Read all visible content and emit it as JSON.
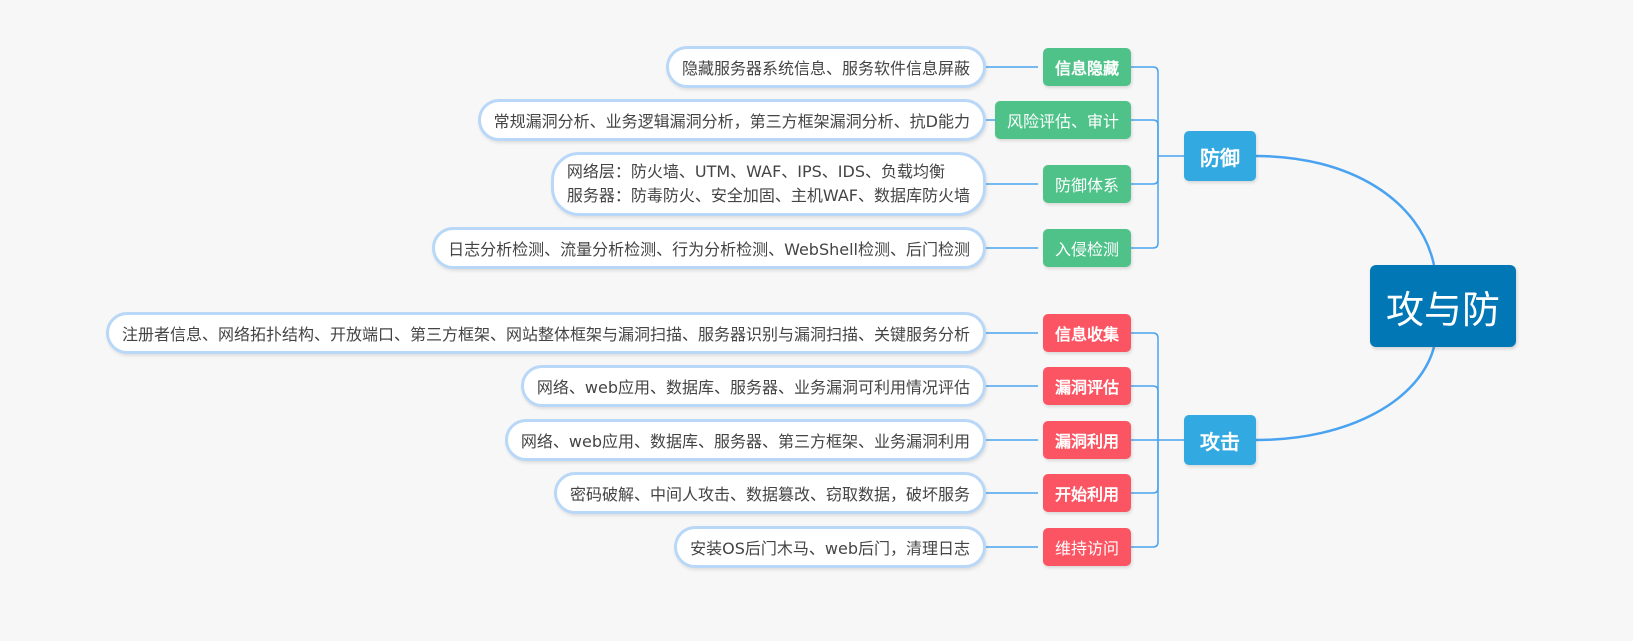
{
  "root": {
    "label": "攻与防"
  },
  "colors": {
    "root": "#0277b5",
    "main": "#32a9e0",
    "defense_sub": "#4fc28a",
    "attack_sub": "#fb5462",
    "connector": "#4aa3f0",
    "leaf_border": "#b9d8f8",
    "background": "#f7f7f7"
  },
  "branches": [
    {
      "label": "防御",
      "children": [
        {
          "label": "信息隐藏",
          "bold": true,
          "detail": [
            "隐藏服务器系统信息、服务软件信息屏蔽"
          ]
        },
        {
          "label": "风险评估、审计",
          "bold": false,
          "detail": [
            "常规漏洞分析、业务逻辑漏洞分析，第三方框架漏洞分析、抗D能力"
          ]
        },
        {
          "label": "防御体系",
          "bold": false,
          "detail": [
            "网络层：防火墙、UTM、WAF、IPS、IDS、负载均衡",
            "服务器：防毒防火、安全加固、主机WAF、数据库防火墙"
          ]
        },
        {
          "label": "入侵检测",
          "bold": false,
          "detail": [
            "日志分析检测、流量分析检测、行为分析检测、WebShell检测、后门检测"
          ]
        }
      ]
    },
    {
      "label": "攻击",
      "children": [
        {
          "label": "信息收集",
          "bold": true,
          "detail": [
            "注册者信息、网络拓扑结构、开放端口、第三方框架、网站整体框架与漏洞扫描、服务器识别与漏洞扫描、关键服务分析"
          ]
        },
        {
          "label": "漏洞评估",
          "bold": true,
          "detail": [
            "网络、web应用、数据库、服务器、业务漏洞可利用情况评估"
          ]
        },
        {
          "label": "漏洞利用",
          "bold": true,
          "detail": [
            "网络、web应用、数据库、服务器、第三方框架、业务漏洞利用"
          ]
        },
        {
          "label": "开始利用",
          "bold": true,
          "detail": [
            "密码破解、中间人攻击、数据篡改、窃取数据，破坏服务"
          ]
        },
        {
          "label": "维持访问",
          "bold": false,
          "detail": [
            "安装OS后门木马、web后门，清理日志"
          ]
        }
      ]
    }
  ]
}
